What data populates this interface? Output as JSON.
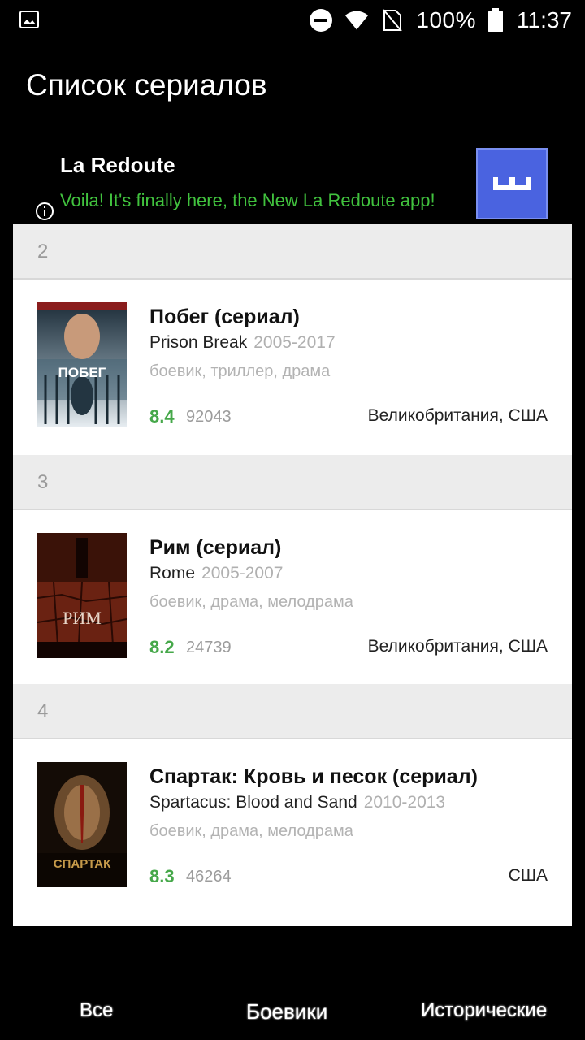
{
  "status_bar": {
    "battery_percent": "100%",
    "time": "11:37",
    "icons": [
      "gallery-icon",
      "dnd-icon",
      "wifi-icon",
      "no-sim-icon",
      "battery-icon"
    ]
  },
  "header": {
    "title": "Список сериалов"
  },
  "ad": {
    "title": "La Redoute",
    "text": "Voila! It's finally here, the New La Redoute app!",
    "info_icon": "info-icon",
    "accent_color": "#41c23e",
    "logo_color": "#4a63e0"
  },
  "list": {
    "items": [
      {
        "rank": "2",
        "title": "Побег (сериал)",
        "original": "Prison Break",
        "years": "2005-2017",
        "genres": "боевик, триллер, драма",
        "rating": "8.4",
        "votes": "92043",
        "country": "Великобритания, США",
        "poster_text": "ПОБЕГ"
      },
      {
        "rank": "3",
        "title": "Рим (сериал)",
        "original": "Rome",
        "years": "2005-2007",
        "genres": "боевик, драма, мелодрама",
        "rating": "8.2",
        "votes": "24739",
        "country": "Великобритания, США",
        "poster_text": "РИМ"
      },
      {
        "rank": "4",
        "title": "Спартак: Кровь и песок (сериал)",
        "original": "Spartacus: Blood and Sand",
        "years": "2010-2013",
        "genres": "боевик, драма, мелодрама",
        "rating": "8.3",
        "votes": "46264",
        "country": "США",
        "poster_text": "СПАРТАК"
      }
    ]
  },
  "tabs": [
    {
      "label": "Все",
      "active": false
    },
    {
      "label": "Боевики",
      "active": true
    },
    {
      "label": "Исторические",
      "active": false
    }
  ],
  "colors": {
    "rating": "#46a84a",
    "rank_bg": "#ececec",
    "background": "#000000"
  }
}
